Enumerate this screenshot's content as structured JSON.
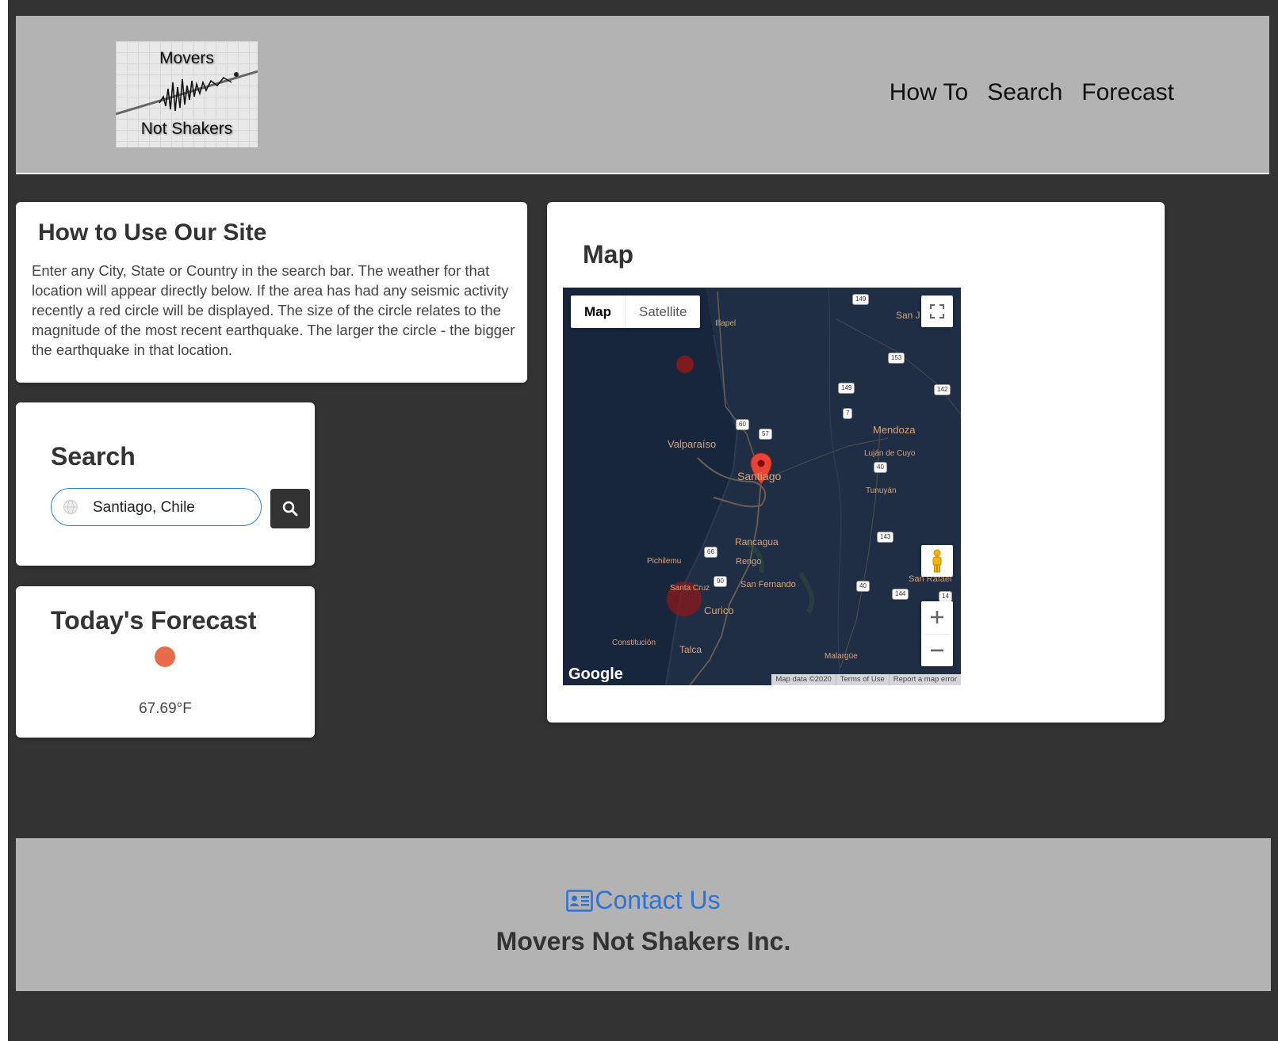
{
  "logo": {
    "line1": "Movers",
    "line2": "Not Shakers"
  },
  "nav": {
    "how_to": "How To",
    "search": "Search",
    "forecast": "Forecast"
  },
  "howto": {
    "title": "How to Use Our Site",
    "body": "Enter any City, State or Country in the search bar. The weather for that location will appear directly below. If the area has had any seismic activity recently a red circle will be displayed. The size of the circle relates to the magnitude of the most recent earthquake. The larger the circle - the bigger the earthquake in that location."
  },
  "search": {
    "title": "Search",
    "value": "Santiago, Chile",
    "icon": "search-icon"
  },
  "forecast": {
    "title": "Today's Forecast",
    "temperature": "67.69°F",
    "icon_color": "#ea6b4a"
  },
  "map": {
    "title": "Map",
    "type_map": "Map",
    "type_satellite": "Satellite",
    "google": "Google",
    "attribution": [
      "Map data ©2020",
      "Terms of Use",
      "Report a map error"
    ],
    "places": {
      "illapel": "Illapel",
      "san_juan": "San J",
      "valparaiso": "Valparaíso",
      "santiago": "Santiago",
      "mendoza": "Mendoza",
      "lujan": "Luján de Cuyo",
      "tunuyan": "Tunuyán",
      "rancagua": "Rancagua",
      "pichilemu": "Pichilemu",
      "rengo": "Rengo",
      "santa_cruz": "Santa Cruz",
      "san_fernando": "San Fernando",
      "san_rafael": "San Rafael",
      "curico": "Curico",
      "constitucion": "Constitución",
      "talca": "Talca",
      "malargue": "Malargüe"
    },
    "route_shields": [
      "149",
      "153",
      "149",
      "142",
      "7",
      "60",
      "57",
      "40",
      "143",
      "66",
      "90",
      "40",
      "144",
      "14"
    ]
  },
  "footer": {
    "contact": "Contact Us",
    "company": "Movers Not Shakers Inc."
  },
  "colors": {
    "background": "#333333",
    "header": "#b3b3b3",
    "link": "#2d73d6",
    "map_bg": "#17263c",
    "quake": "#8b1a1a"
  }
}
